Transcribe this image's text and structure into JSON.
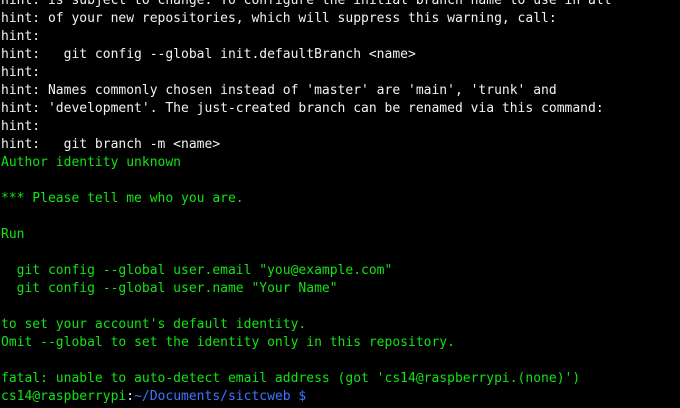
{
  "terminal": {
    "colors": {
      "background": "#000000",
      "text": "#f2f2f2",
      "green": "#13e313",
      "blue": "#3b78ff"
    },
    "lines": [
      "hint: is subject to change. To configure the initial branch name to use in all",
      "hint: of your new repositories, which will suppress this warning, call:",
      "hint:",
      "hint:   git config --global init.defaultBranch <name>",
      "hint:",
      "hint: Names commonly chosen instead of 'master' are 'main', 'trunk' and",
      "hint: 'development'. The just-created branch can be renamed via this command:",
      "hint:",
      "hint:   git branch -m <name>",
      "Author identity unknown",
      "",
      "*** Please tell me who you are.",
      "",
      "Run",
      "",
      "  git config --global user.email \"you@example.com\"",
      "  git config --global user.name \"Your Name\"",
      "",
      "to set your account's default identity.",
      "Omit --global to set the identity only in this repository.",
      "",
      "fatal: unable to auto-detect email address (got 'cs14@raspberrypi.(none)')"
    ],
    "prompt": {
      "user_host": "cs14@raspberrypi",
      "colon": ":",
      "path": "~/Documents/sictcweb",
      "dollar": " $"
    }
  }
}
